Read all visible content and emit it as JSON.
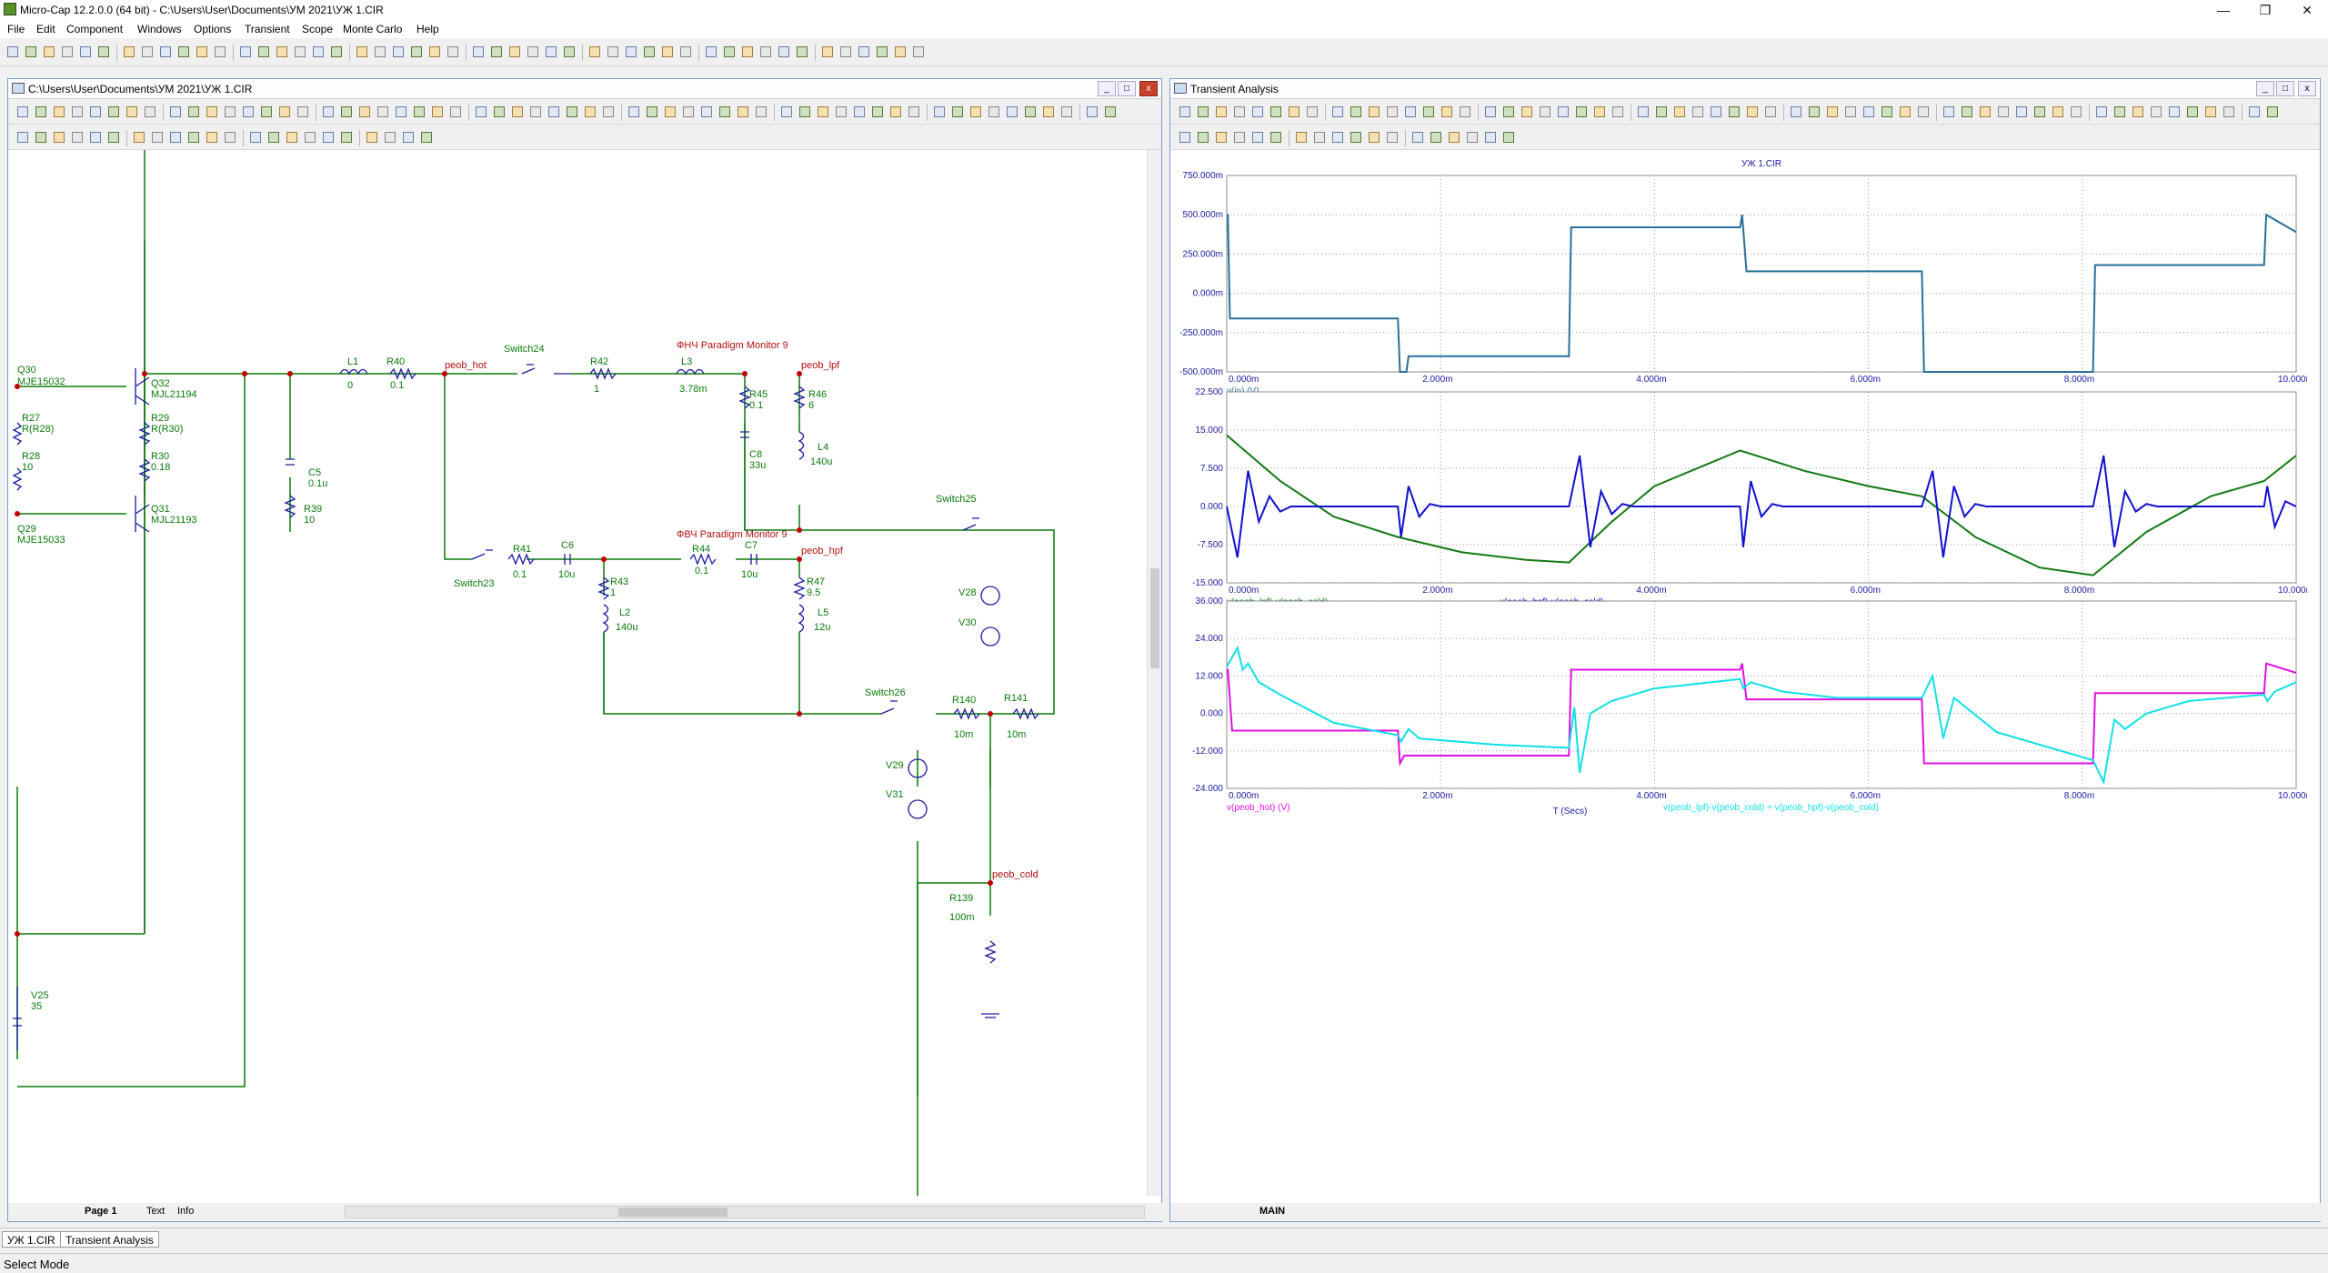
{
  "app": {
    "title": "Micro-Cap 12.2.0.0 (64 bit) - C:\\Users\\User\\Documents\\УМ 2021\\УЖ 1.CIR",
    "minimize": "—",
    "restore": "❐",
    "close": "✕"
  },
  "menu": [
    "File",
    "Edit",
    "Component",
    "Windows",
    "Options",
    "Transient",
    "Scope",
    "Monte Carlo",
    "Help"
  ],
  "schematic": {
    "title": "C:\\Users\\User\\Documents\\УМ 2021\\УЖ 1.CIR",
    "labels": {
      "q30": "Q30",
      "q30m": "MJE15032",
      "q32": "Q32",
      "q32m": "MJL21194",
      "r27": "R27",
      "r27v": "R(R28)",
      "r29": "R29",
      "r29v": "R(R30)",
      "r28": "R28",
      "r28v": "10",
      "r30": "R30",
      "r30v": "0.18",
      "q31": "Q31",
      "q31m": "MJL21193",
      "q29": "Q29",
      "q29m": "MJE15033",
      "l1": "L1",
      "l1v": "0",
      "r40": "R40",
      "r40v": "0.1",
      "peob_hot": "peob_hot",
      "c5": "C5",
      "c5v": "0.1u",
      "r39": "R39",
      "r39v": "10",
      "switch24": "Switch24",
      "r42": "R42",
      "r42v": "1",
      "l3": "L3",
      "l3v": "3.78m",
      "fnch": "ФНЧ Paradigm Monitor 9",
      "peob_lpf": "peob_lpf",
      "r45": "R45",
      "r45v": "0.1",
      "r46": "R46",
      "r46v": "6",
      "c8": "C8",
      "c8v": "33u",
      "l4": "L4",
      "l4v": "140u",
      "switch25": "Switch25",
      "v28": "V28",
      "v30": "V30",
      "fvch": "ФВЧ Paradigm Monitor 9",
      "peob_hpf": "peob_hpf",
      "r41": "R41",
      "r41v": "0.1",
      "c6": "C6",
      "c6v": "10u",
      "r44": "R44",
      "r44v": "0.1",
      "c7": "C7",
      "c7v": "10u",
      "switch23": "Switch23",
      "r43": "R43",
      "r43v": "1",
      "l2": "L2",
      "l2v": "140u",
      "r47": "R47",
      "r47v": "9.5",
      "l5": "L5",
      "l5v": "12u",
      "switch26": "Switch26",
      "r140": "R140",
      "r140v": "10m",
      "r141": "R141",
      "r141v": "10m",
      "v29": "V29",
      "v31": "V31",
      "peob_cold": "peob_cold",
      "r139": "R139",
      "r139v": "100m",
      "v25": "V25",
      "v25v": "35"
    },
    "tabs": [
      "Page 1",
      "Text",
      "Info"
    ]
  },
  "transient": {
    "title": "Transient Analysis",
    "plot_title": "УЖ 1.CIR",
    "tab": "MAIN",
    "x_axis_label": "T (Secs)"
  },
  "colors": {
    "wire": "#0a7a0a",
    "component": "#1a1aa0",
    "node": "#c00000",
    "trace1": "#2a6f9a",
    "green": "#127a12",
    "blue": "#1010d0",
    "magenta": "#e010e0",
    "cyan": "#10e0e8"
  },
  "chart_data": [
    {
      "type": "line",
      "title": "УЖ 1.CIR",
      "xlim": [
        0,
        0.01
      ],
      "ylim": [
        -0.5,
        0.75
      ],
      "xticks": [
        "0.000m",
        "2.000m",
        "4.000m",
        "6.000m",
        "8.000m",
        "10.000m"
      ],
      "yticks": [
        "750.000m",
        "500.000m",
        "250.000m",
        "0.000m",
        "-250.000m",
        "-500.000m"
      ],
      "series": [
        {
          "name": "v(in) (V)",
          "color": "#2a6f9a",
          "x": [
            0,
            1e-05,
            3e-05,
            0.0016,
            0.00162,
            0.00168,
            0.0017,
            0.0032,
            0.00322,
            0.0048,
            0.00482,
            0.00486,
            0.0065,
            0.00652,
            0.0081,
            0.00812,
            0.0097,
            0.00972,
            0.01
          ],
          "y": [
            0.5,
            0.5,
            -0.16,
            -0.16,
            -0.5,
            -0.5,
            -0.4,
            -0.4,
            0.42,
            0.42,
            0.5,
            0.14,
            0.14,
            -0.5,
            -0.5,
            0.18,
            0.18,
            0.5,
            0.39
          ]
        }
      ]
    },
    {
      "type": "line",
      "xlim": [
        0,
        0.01
      ],
      "ylim": [
        -15,
        22.5
      ],
      "xticks": [
        "0.000m",
        "2.000m",
        "4.000m",
        "6.000m",
        "8.000m",
        "10.000m"
      ],
      "yticks": [
        "22.500",
        "15.000",
        "7.500",
        "0.000",
        "-7.500",
        "-15.000"
      ],
      "series": [
        {
          "name": "v(peob_lpf)-v(peob_cold)",
          "color": "#127a12",
          "x": [
            0,
            0.0005,
            0.001,
            0.0016,
            0.0022,
            0.0028,
            0.0032,
            0.0036,
            0.004,
            0.0048,
            0.0054,
            0.006,
            0.0065,
            0.007,
            0.0076,
            0.0081,
            0.0086,
            0.0092,
            0.0097,
            0.01
          ],
          "y": [
            14,
            5,
            -2,
            -6,
            -9,
            -10.5,
            -11,
            -3,
            4,
            11,
            7,
            4,
            2,
            -6,
            -12,
            -13.5,
            -5,
            2,
            5,
            10
          ]
        },
        {
          "name": "v(peob_hpf)-v(peob_cold)",
          "color": "#1010d0",
          "x": [
            0,
            0.0001,
            0.0002,
            0.0003,
            0.0004,
            0.0005,
            0.0006,
            0.0008,
            0.0016,
            0.00163,
            0.0017,
            0.0018,
            0.0019,
            0.002,
            0.0032,
            0.0033,
            0.0034,
            0.0035,
            0.0036,
            0.0037,
            0.0038,
            0.004,
            0.0048,
            0.00483,
            0.0049,
            0.005,
            0.0051,
            0.0052,
            0.0065,
            0.0066,
            0.0067,
            0.0068,
            0.0069,
            0.007,
            0.0071,
            0.0073,
            0.0081,
            0.0082,
            0.0083,
            0.0084,
            0.0085,
            0.0086,
            0.0087,
            0.0089,
            0.0097,
            0.00973,
            0.0098,
            0.0099,
            0.01
          ],
          "y": [
            0,
            -10,
            7,
            -3,
            2,
            -1,
            0,
            0,
            0,
            -6,
            4,
            -2,
            0.5,
            0,
            0,
            10,
            -8,
            3,
            -1.5,
            0.5,
            0,
            0,
            0,
            -8,
            5,
            -2,
            0.5,
            0,
            0,
            7,
            -10,
            4,
            -2,
            0.5,
            0,
            0,
            0,
            10,
            -8,
            3,
            -1,
            0.5,
            0,
            0,
            0,
            4,
            -4,
            1,
            0
          ]
        }
      ]
    },
    {
      "type": "line",
      "xlim": [
        0,
        0.01
      ],
      "ylim": [
        -24,
        36
      ],
      "xticks": [
        "0.000m",
        "2.000m",
        "4.000m",
        "6.000m",
        "8.000m",
        "10.000m"
      ],
      "yticks": [
        "36.000",
        "24.000",
        "12.000",
        "0.000",
        "-12.000",
        "-24.000"
      ],
      "series": [
        {
          "name": "v(peob_hot) (V)",
          "color": "#e010e0",
          "x": [
            0,
            1e-05,
            5e-05,
            0.0016,
            0.00162,
            0.00166,
            0.0032,
            0.00322,
            0.0048,
            0.00482,
            0.00486,
            0.0065,
            0.00652,
            0.0081,
            0.00812,
            0.0097,
            0.00972,
            0.01
          ],
          "y": [
            14,
            14,
            -5.5,
            -5.5,
            -16,
            -13.5,
            -13.5,
            14,
            14,
            16,
            4.5,
            4.5,
            -16,
            -16,
            6.5,
            6.5,
            16,
            13
          ]
        },
        {
          "name": "v(peob_lpf)-v(peob_cold) + v(peob_hpf)-v(peob_cold)",
          "color": "#10e0e8",
          "x": [
            0,
            0.0001,
            0.00015,
            0.0002,
            0.0003,
            0.0005,
            0.001,
            0.0016,
            0.00163,
            0.0017,
            0.0018,
            0.0025,
            0.0032,
            0.00325,
            0.0033,
            0.0034,
            0.0036,
            0.004,
            0.0048,
            0.00483,
            0.0049,
            0.0052,
            0.0057,
            0.0065,
            0.0066,
            0.0067,
            0.0068,
            0.0072,
            0.0081,
            0.0082,
            0.0083,
            0.0084,
            0.0086,
            0.009,
            0.0097,
            0.00973,
            0.0098,
            0.01
          ],
          "y": [
            15,
            21,
            14,
            16,
            10,
            6,
            -3,
            -7,
            -9,
            -5,
            -8,
            -10,
            -11,
            2,
            -19,
            0,
            4,
            8,
            11,
            8,
            10,
            7,
            5,
            5,
            12,
            -8,
            5,
            -6,
            -15,
            -22,
            -2,
            -5,
            0,
            4,
            6,
            4,
            7,
            10
          ]
        }
      ]
    }
  ]
}
